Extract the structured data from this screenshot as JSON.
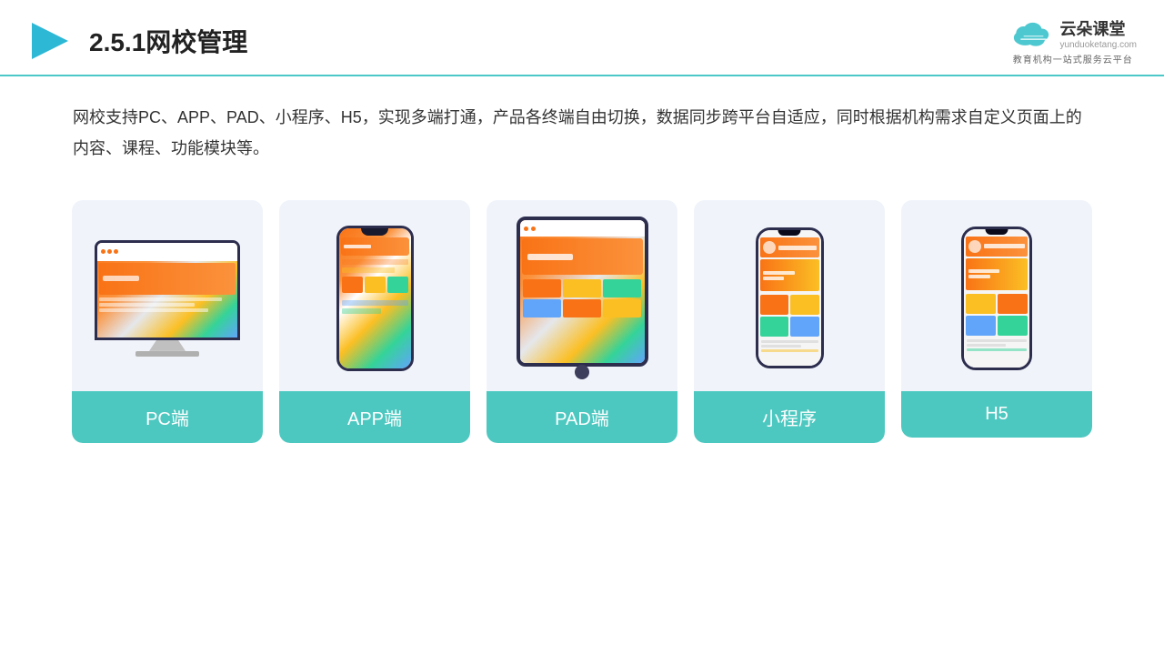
{
  "header": {
    "title": "2.5.1网校管理",
    "logo_name": "云朵课堂",
    "logo_url": "yunduoketang.com",
    "logo_tagline": "教育机构一站式服务云平台"
  },
  "description": {
    "text": "网校支持PC、APP、PAD、小程序、H5，实现多端打通，产品各终端自由切换，数据同步跨平台自适应，同时根据机构需求自定义页面上的内容、课程、功能模块等。"
  },
  "cards": [
    {
      "label": "PC端",
      "type": "pc"
    },
    {
      "label": "APP端",
      "type": "phone"
    },
    {
      "label": "PAD端",
      "type": "tablet"
    },
    {
      "label": "小程序",
      "type": "phone-slim"
    },
    {
      "label": "H5",
      "type": "phone-slim2"
    }
  ]
}
